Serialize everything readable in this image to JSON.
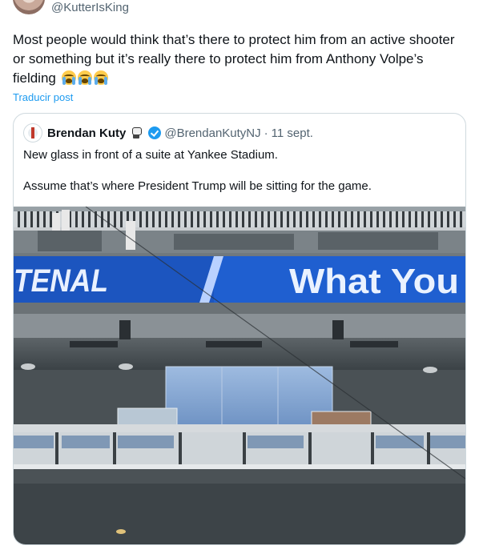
{
  "author": {
    "handle": "@KutterIsKing"
  },
  "tweet": {
    "text": "Most people would think that’s there to protect him from an active shooter or something but it’s really there to protect him from Anthony Volpe’s fielding",
    "emojis": [
      "loudly-crying-face",
      "loudly-crying-face",
      "loudly-crying-face"
    ],
    "translate_label": "Traducir post"
  },
  "quoted": {
    "name": "Brendan Kuty",
    "name_emoji": "mime-face",
    "verified": true,
    "handle": "@BrendanKutyNJ",
    "separator": "·",
    "date": "11 sept.",
    "lines": [
      "New glass in front of a suite at Yankee Stadium.",
      "Assume that’s where President Trump will be sitting for the game."
    ],
    "image": {
      "scoreboard_left": "TENAL",
      "scoreboard_right": "What You"
    }
  },
  "colors": {
    "accent": "#1d9bf0",
    "scoreboard": "#1f5fd0"
  }
}
